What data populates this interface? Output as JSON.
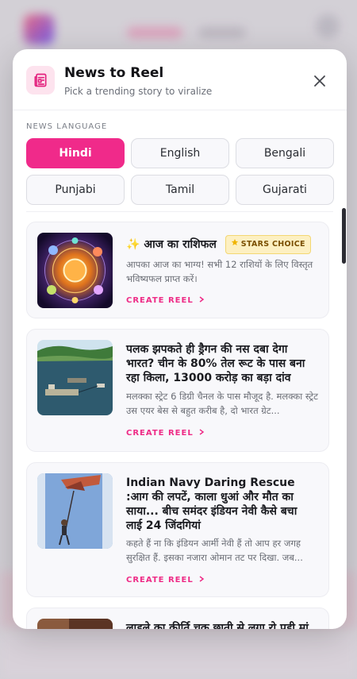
{
  "modal": {
    "title": "News to Reel",
    "subtitle": "Pick a trending story to viralize",
    "close_icon": "close-icon",
    "header_icon": "newspaper-icon"
  },
  "language": {
    "label": "NEWS LANGUAGE",
    "selected": "Hindi",
    "options": [
      "Hindi",
      "English",
      "Bengali",
      "Punjabi",
      "Tamil",
      "Gujarati"
    ]
  },
  "stories": [
    {
      "emoji": "✨",
      "title": "आज का राशिफल",
      "badge": "STARS CHOICE",
      "badge_icon": "star-icon",
      "description": "आपका आज का भाग्य! सभी 12 राशियों के लिए विस्तृत भविष्यफल प्राप्त करें।",
      "action": "CREATE REEL"
    },
    {
      "title": "पलक झपकते ही ड्रैगन की नस दबा देगा भारत? चीन के 80% तेल रूट के पास बना रहा किला, 13000 करोड़ का बड़ा दांव",
      "description": "मलक्का स्ट्रेट 6 डिग्री चैनल के पास मौजूद है. मलक्का स्ट्रेट उस एयर बेस से बहुत करीब है, दो भारत ग्रेट...",
      "action": "CREATE REEL"
    },
    {
      "title": "Indian Navy Daring Rescue :आग की लपटें, काला धुआं और मौत का साया... बीच समंदर इंडियन नेवी कैसे बचा लाई 24 जिंदगियां",
      "description": "कहते हैं ना कि इंडियन आर्मी नेवी हैं तो आप हर जगह सुरक्षित हैं. इसका नजारा ओमान तट पर दिखा. जब...",
      "action": "CREATE REEL"
    },
    {
      "title": "लाडले का कीर्ति चक्र छाती से लगा रो पड़ी मां"
    }
  ],
  "colors": {
    "accent": "#f02a8a",
    "badge_bg": "#fdf0c2"
  }
}
